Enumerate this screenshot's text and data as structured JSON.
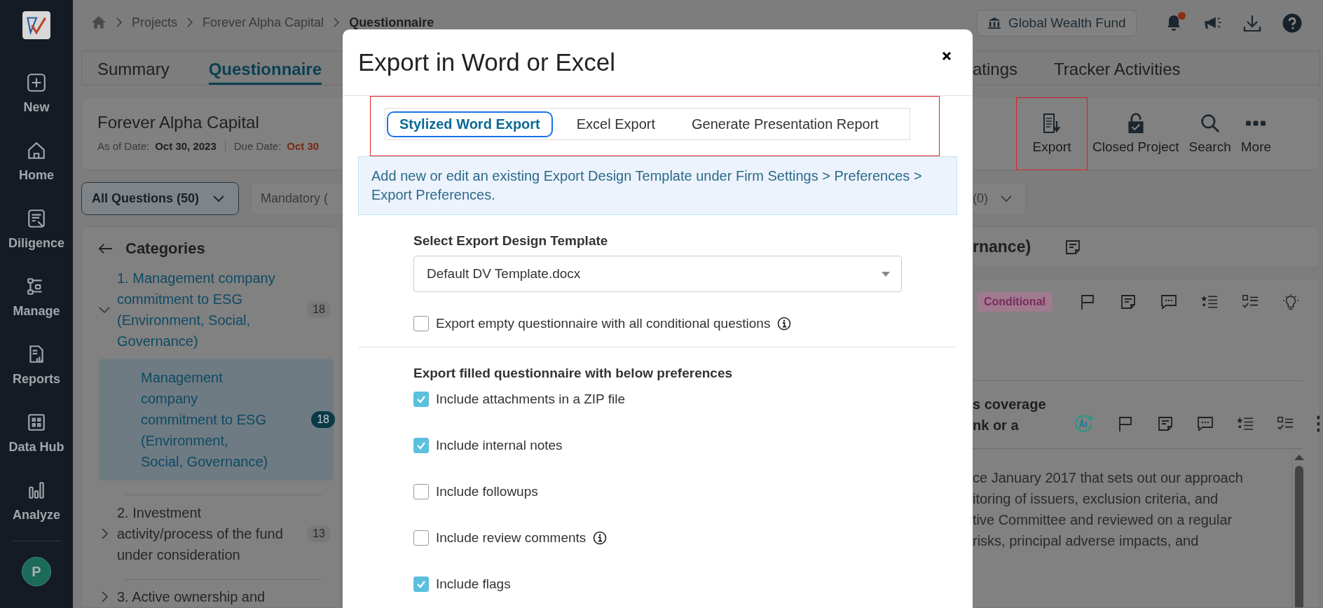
{
  "sidebar": {
    "items": [
      {
        "label": "New",
        "kind": "new",
        "selected": false
      },
      {
        "label": "Home",
        "kind": "home",
        "selected": false
      },
      {
        "label": "Diligence",
        "kind": "diligence",
        "selected": false
      },
      {
        "label": "Manage",
        "kind": "manage",
        "selected": false
      },
      {
        "label": "Reports",
        "kind": "reports",
        "selected": false
      },
      {
        "label": "Data Hub",
        "kind": "datahub",
        "selected": false
      },
      {
        "label": "Analyze",
        "kind": "analyze",
        "selected": false
      }
    ],
    "avatar": "P"
  },
  "breadcrumb": [
    "Projects",
    "Forever Alpha Capital",
    "Questionnaire"
  ],
  "fund_selector": "Global Wealth Fund",
  "notifications": {
    "unread": true
  },
  "main_tabs": [
    {
      "label": "Summary",
      "selected": false
    },
    {
      "label": "Questionnaire",
      "selected": true
    },
    {
      "label": "atings",
      "selected": false
    },
    {
      "label": "Tracker Activities",
      "selected": false
    }
  ],
  "project": {
    "name": "Forever Alpha Capital",
    "as_of_label": "As of Date:",
    "as_of": "Oct 30, 2023",
    "due_label": "Due Date:",
    "due": "Oct 30"
  },
  "toolbar": [
    {
      "label": "Export",
      "kind": "export",
      "highlighted": true
    },
    {
      "label": "Closed Project",
      "kind": "lock",
      "highlighted": false
    },
    {
      "label": "Search",
      "kind": "search",
      "highlighted": false
    },
    {
      "label": "More",
      "kind": "more",
      "highlighted": false
    }
  ],
  "filters": [
    {
      "label": "All Questions (50)",
      "selected": true
    },
    {
      "label": "Mandatory (",
      "selected": false
    },
    {
      "label": "(0)",
      "selected": false
    }
  ],
  "categories": {
    "title": "Categories",
    "items": [
      {
        "label": "1. Management company commitment to ESG (Environment, Social, Governance)",
        "count": "18",
        "expanded": true,
        "selected": false,
        "children": [
          {
            "label": "Management company commitment to ESG (Environment, Social, Governance)",
            "count": "18",
            "selected": true
          }
        ]
      },
      {
        "label": "2. Investment activity/process of the fund under consideration",
        "count": "13",
        "expanded": false,
        "selected": false
      },
      {
        "label": "3. Active ownership and",
        "expanded": false,
        "selected": false
      }
    ]
  },
  "section_title": "rnance)",
  "question_1": {
    "tag": "Conditional"
  },
  "question_2": {
    "title": [
      "s coverage",
      "nk or a"
    ],
    "answer": [
      "ce January 2017 that sets out our approach",
      "itoring of issuers, exclusion criteria, and",
      "tive Committee and reviewed on a regular",
      "risks, principal adverse impacts, and"
    ]
  },
  "modal": {
    "title": "Export in Word or Excel",
    "tabs": [
      {
        "label": "Stylized Word Export",
        "selected": true
      },
      {
        "label": "Excel Export",
        "selected": false
      },
      {
        "label": "Generate Presentation Report",
        "selected": false
      }
    ],
    "notice": "Add new or edit an existing Export Design Template under Firm Settings > Preferences > Export Preferences.",
    "template_label": "Select Export Design Template",
    "template_value": "Default DV Template.docx",
    "empty_option": {
      "label": "Export empty questionnaire with all conditional questions",
      "checked": false,
      "info": true
    },
    "filled_heading": "Export filled questionnaire with below preferences",
    "options": [
      {
        "label": "Include attachments in a ZIP file",
        "checked": true,
        "info": false
      },
      {
        "label": "Include internal notes",
        "checked": true,
        "info": false
      },
      {
        "label": "Include followups",
        "checked": false,
        "info": false
      },
      {
        "label": "Include review comments",
        "checked": false,
        "info": true
      },
      {
        "label": "Include flags",
        "checked": true,
        "info": false
      }
    ]
  }
}
